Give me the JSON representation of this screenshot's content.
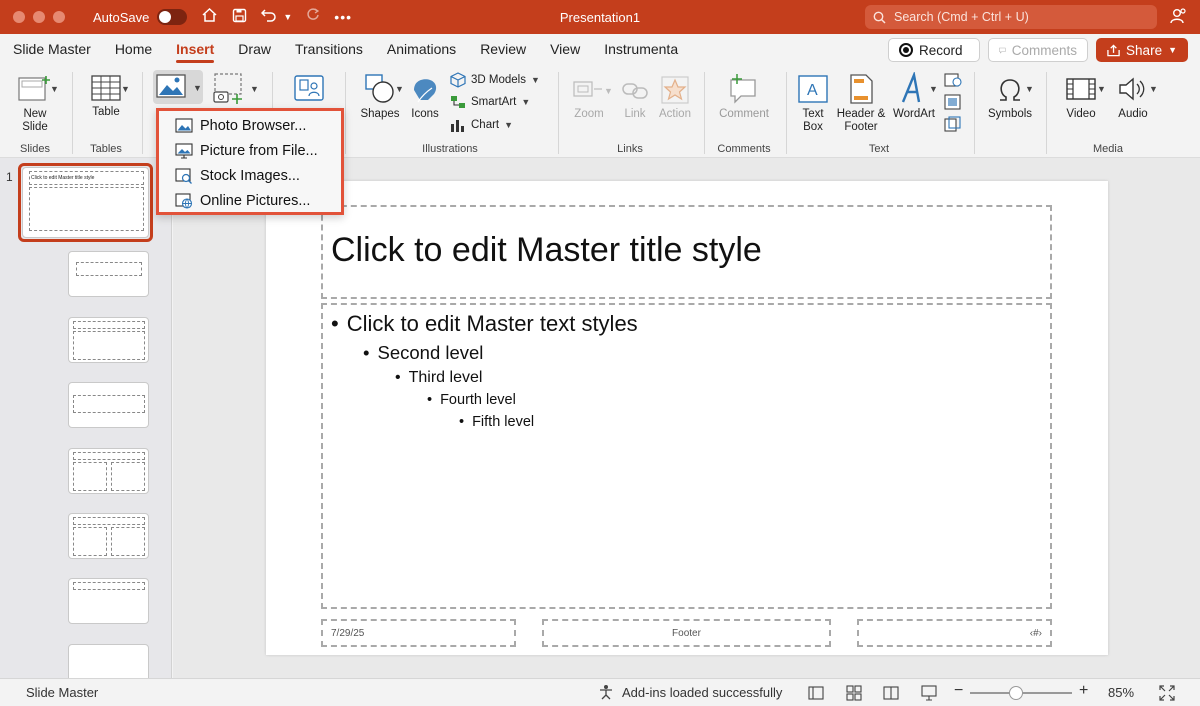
{
  "titlebar": {
    "autosave_label": "AutoSave",
    "doc_title": "Presentation1",
    "search_placeholder": "Search (Cmd + Ctrl + U)"
  },
  "tabs": [
    "Slide Master",
    "Home",
    "Insert",
    "Draw",
    "Transitions",
    "Animations",
    "Review",
    "View",
    "Instrumenta"
  ],
  "active_tab": "Insert",
  "buttons": {
    "record": "Record",
    "comments": "Comments",
    "share": "Share"
  },
  "ribbon": {
    "new_slide": "New Slide",
    "table": "Table",
    "shapes": "Shapes",
    "icons": "Icons",
    "models3d": "3D Models",
    "smartart": "SmartArt",
    "chart": "Chart",
    "zoom": "Zoom",
    "link": "Link",
    "action": "Action",
    "comment": "Comment",
    "textbox": "Text Box",
    "header_footer": "Header & Footer",
    "wordart": "WordArt",
    "symbols": "Symbols",
    "video": "Video",
    "audio": "Audio",
    "groups": {
      "slides": "Slides",
      "tables": "Tables",
      "illustrations": "Illustrations",
      "links": "Links",
      "comments": "Comments",
      "text": "Text",
      "media": "Media"
    }
  },
  "pictures_menu": [
    "Photo Browser...",
    "Picture from File...",
    "Stock Images...",
    "Online Pictures..."
  ],
  "thumbs": {
    "number": "1",
    "title": "Click to edit Master title style"
  },
  "slide": {
    "title": "Click to edit Master title style",
    "levels": [
      "Click to edit Master text styles",
      "Second level",
      "Third level",
      "Fourth level",
      "Fifth level"
    ],
    "date": "7/29/25",
    "footer": "Footer",
    "page_num": "‹#›"
  },
  "status": {
    "view": "Slide Master",
    "addins": "Add-ins loaded successfully",
    "zoom_level": 0.45,
    "zoom": "85%"
  },
  "colors": {
    "accent": "#c43e1c",
    "highlight": "#e2533a"
  }
}
